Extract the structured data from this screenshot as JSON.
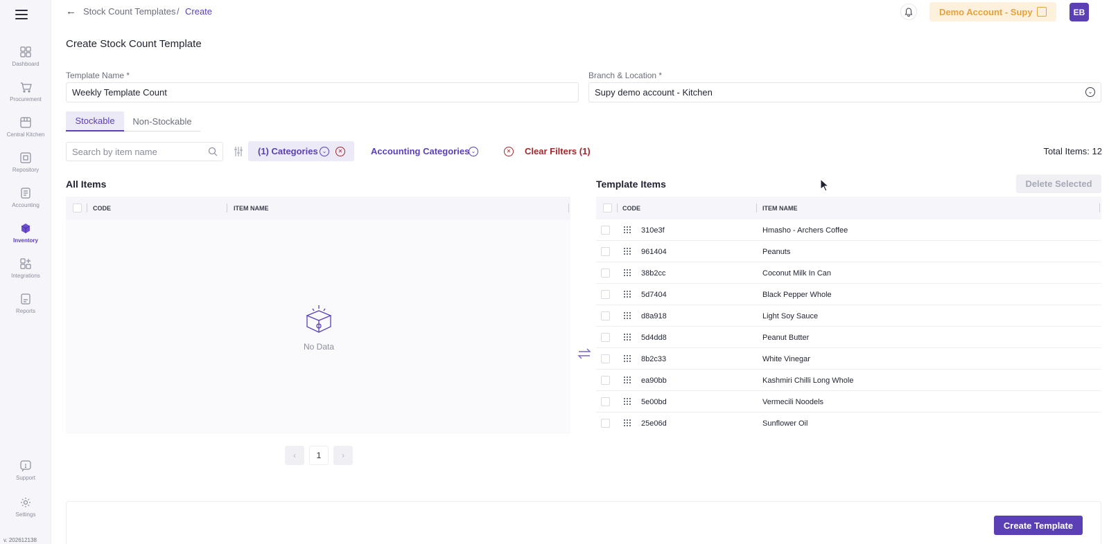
{
  "sidebar": {
    "items": [
      {
        "label": "Dashboard",
        "icon": "dashboard-icon"
      },
      {
        "label": "Procurement",
        "icon": "cart-icon"
      },
      {
        "label": "Central Kitchen",
        "icon": "kitchen-icon"
      },
      {
        "label": "Repository",
        "icon": "repository-icon"
      },
      {
        "label": "Accounting",
        "icon": "accounting-icon"
      },
      {
        "label": "Inventory",
        "icon": "inventory-cube-icon",
        "active": true
      },
      {
        "label": "Integrations",
        "icon": "integrations-icon"
      },
      {
        "label": "Reports",
        "icon": "reports-icon"
      }
    ],
    "bottom_items": [
      {
        "label": "Support",
        "icon": "support-icon"
      },
      {
        "label": "Settings",
        "icon": "gear-icon"
      }
    ],
    "version": "v. 202612138"
  },
  "header": {
    "breadcrumb_parent": "Stock Count Templates",
    "breadcrumb_sep": "/",
    "breadcrumb_current": "Create",
    "account_name": "Demo Account - Supy",
    "avatar_initials": "EB"
  },
  "page": {
    "title": "Create Stock Count Template",
    "template_name_label": "Template Name *",
    "template_name_value": "Weekly Template Count",
    "branch_label": "Branch & Location *",
    "branch_value": "Supy demo account  - Kitchen"
  },
  "tabs": [
    {
      "label": "Stockable",
      "active": true
    },
    {
      "label": "Non-Stockable",
      "active": false
    }
  ],
  "filters": {
    "search_placeholder": "Search by item name",
    "categories_chip": "(1) Categories",
    "accounting_categories": "Accounting Categories",
    "clear_filters": "Clear Filters (1)",
    "total_items": "Total Items: 12"
  },
  "all_items": {
    "title": "All Items",
    "columns": [
      "CODE",
      "ITEM NAME"
    ],
    "empty_text": "No Data",
    "pagination": {
      "current_page": "1"
    }
  },
  "template_items": {
    "title": "Template Items",
    "delete_selected": "Delete Selected",
    "columns": [
      "CODE",
      "ITEM NAME"
    ],
    "rows": [
      {
        "code": "310e3f",
        "name": "Hmasho - Archers Coffee"
      },
      {
        "code": "961404",
        "name": "Peanuts"
      },
      {
        "code": "38b2cc",
        "name": "Coconut Milk In Can"
      },
      {
        "code": "5d7404",
        "name": "Black Pepper Whole"
      },
      {
        "code": "d8a918",
        "name": "Light Soy Sauce"
      },
      {
        "code": "5d4dd8",
        "name": "Peanut Butter"
      },
      {
        "code": "8b2c33",
        "name": "White Vinegar"
      },
      {
        "code": "ea90bb",
        "name": "Kashmiri Chilli Long Whole"
      },
      {
        "code": "5e00bd",
        "name": "Vermecili Noodels"
      },
      {
        "code": "25e06d",
        "name": "Sunflower Oil"
      }
    ]
  },
  "footer": {
    "create_button": "Create Template"
  },
  "colors": {
    "accent": "#5a3fb5",
    "danger": "#a0282d",
    "account_bg": "#fdf0dc",
    "account_text": "#e3a33a"
  }
}
